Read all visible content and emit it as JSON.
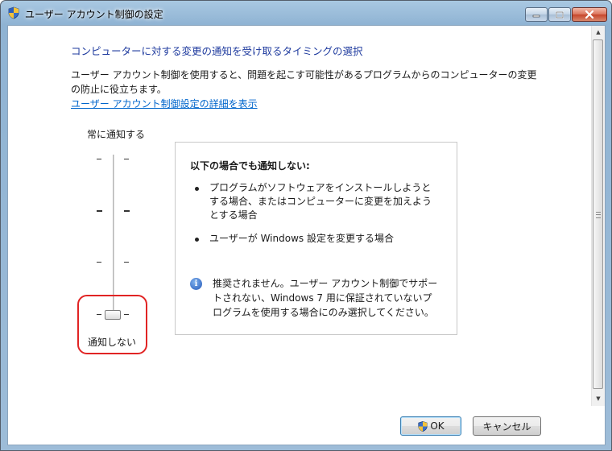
{
  "window": {
    "title": "ユーザー アカウント制御の設定",
    "controls": {
      "minimize": "minimize",
      "maximize": "maximize",
      "close": "close"
    }
  },
  "main": {
    "heading": "コンピューターに対する変更の通知を受け取るタイミングの選択",
    "description": "ユーザー アカウント制御を使用すると、問題を起こす可能性があるプログラムからのコンピューターの変更\nの防止に役立ちます。",
    "details_link": "ユーザー アカウント制御設定の詳細を表示"
  },
  "slider": {
    "top_label": "常に通知する",
    "bottom_label": "通知しない",
    "levels": 4,
    "selected_level": 1
  },
  "info_box": {
    "title": "以下の場合でも通知しない:",
    "bullets": [
      "プログラムがソフトウェアをインストールしようと\nする場合、またはコンピューターに変更を加えよう\nとする場合",
      "ユーザーが Windows 設定を変更する場合"
    ],
    "note": "推奨されません。ユーザー アカウント制御でサポー\nトされない、Windows 7 用に保証されていないプ\nログラムを使用する場合にのみ選択してください。"
  },
  "buttons": {
    "ok": "OK",
    "cancel": "キャンセル"
  },
  "colors": {
    "heading": "#1e3a9e",
    "link": "#0066cc",
    "highlight_ring": "#e12424"
  }
}
